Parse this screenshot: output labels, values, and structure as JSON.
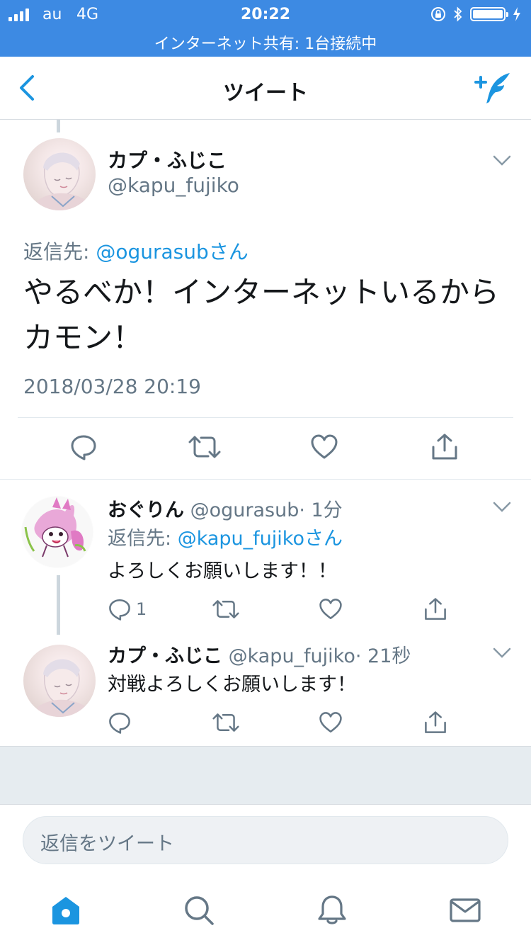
{
  "status_bar": {
    "carrier": "au",
    "network": "4G",
    "time": "20:22",
    "tethering": "インターネット共有: 1台接続中"
  },
  "nav": {
    "title": "ツイート",
    "back_icon": "chevron-left-icon",
    "compose_icon": "compose-tweet-icon"
  },
  "main_tweet": {
    "name": "カプ・ふじこ",
    "handle": "@kapu_fujiko",
    "reply_prefix": "返信先: ",
    "reply_to": "@ogurasubさん",
    "text": "やるべか！インターネットいるからカモン！",
    "timestamp": "2018/03/28 20:19"
  },
  "replies": [
    {
      "name": "おぐりん",
      "handle": "@ogurasub",
      "time": "· 1分",
      "reply_prefix": "返信先: ",
      "reply_to": "@kapu_fujikoさん",
      "text": "よろしくお願いします！！",
      "reply_count": "1"
    },
    {
      "name": "カプ・ふじこ",
      "handle": "@kapu_fujiko",
      "time": "· 21秒",
      "text": "対戦よろしくお願いします！"
    }
  ],
  "compose": {
    "placeholder": "返信をツイート"
  },
  "tabs": [
    "home-icon",
    "search-icon",
    "notifications-bell-icon",
    "messages-mail-icon"
  ],
  "colors": {
    "status_bar": "#3d8ae3",
    "accent": "#1b95e0",
    "secondary_text": "#657786"
  }
}
